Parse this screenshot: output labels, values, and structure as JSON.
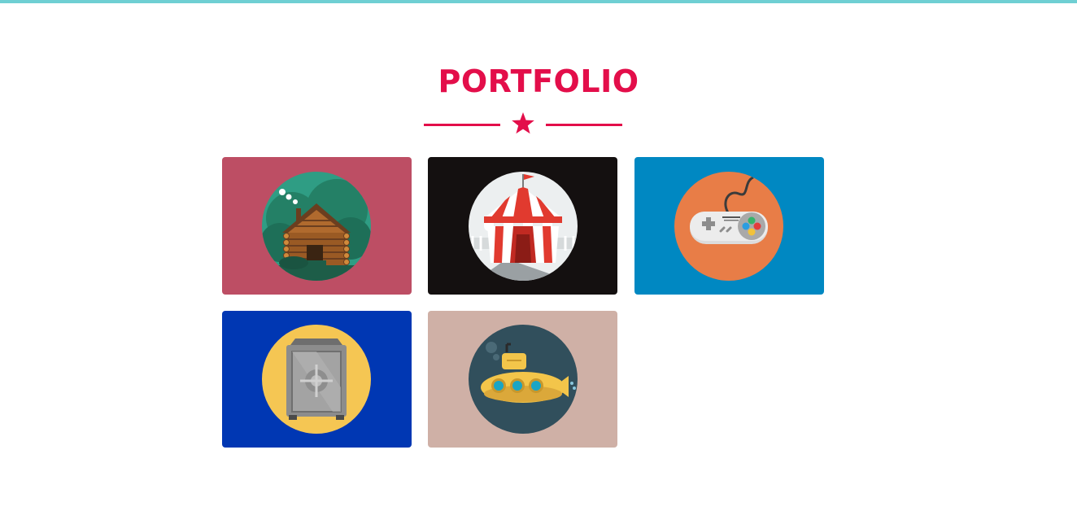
{
  "section": {
    "title": "PORTFOLIO",
    "divider_icon": "star-icon"
  },
  "portfolio_items": [
    {
      "icon": "log-cabin-icon",
      "background": "#bd4e64",
      "circle": "#2f9d84"
    },
    {
      "icon": "circus-tent-icon",
      "background": "#141010",
      "circle": "#eceff0"
    },
    {
      "icon": "game-controller-icon",
      "background": "#0088c2",
      "circle": "#e87d47"
    },
    {
      "icon": "safe-icon",
      "background": "#0037b3",
      "circle": "#f5c653"
    },
    {
      "icon": "submarine-icon",
      "background": "#cfb0a6",
      "circle": "#314f5c"
    }
  ],
  "colors": {
    "accent": "#e30e4a",
    "top_bar": "#6fcfd3"
  }
}
